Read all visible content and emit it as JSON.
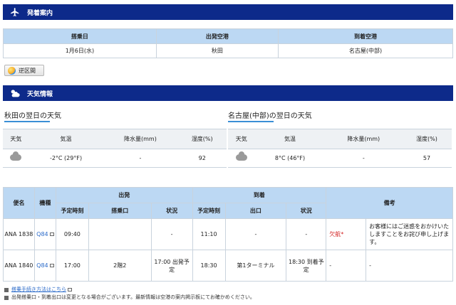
{
  "arrivals_section": {
    "title": "発着案内",
    "icon": "airplane-icon"
  },
  "route_table": {
    "headers": [
      "搭乗日",
      "出発空港",
      "到着空港"
    ],
    "values": [
      "1月6日(水)",
      "秋田",
      "名古屋(中部)"
    ]
  },
  "reverse_button": {
    "label": "逆区間",
    "icon": "globe-icon"
  },
  "weather_section": {
    "title": "天気情報",
    "icon": "weather-icon"
  },
  "weather": [
    {
      "title": "秋田の翌日の天気",
      "headers": [
        "天気",
        "気温",
        "降水量(mm)",
        "湿度(%)"
      ],
      "icon": "cloud-icon",
      "temperature": "-2°C (29°F)",
      "precipitation": "-",
      "humidity": "92"
    },
    {
      "title": "名古屋(中部)の翌日の天気",
      "headers": [
        "天気",
        "気温",
        "降水量(mm)",
        "湿度(%)"
      ],
      "icon": "cloud-icon",
      "temperature": "8°C (46°F)",
      "precipitation": "-",
      "humidity": "57"
    }
  ],
  "flights": {
    "headers": {
      "flight": "便名",
      "aircraft": "機種",
      "departure": "出発",
      "arrival": "到着",
      "remarks": "備考",
      "dep_scheduled": "予定時刻",
      "dep_gate": "搭乗口",
      "dep_status": "状況",
      "arr_scheduled": "予定時刻",
      "arr_exit": "出口",
      "arr_status": "状況"
    },
    "rows": [
      {
        "flight": "ANA 1838",
        "aircraft": "Q84",
        "dep_time": "09:40",
        "dep_gate": "",
        "dep_status": "-",
        "arr_time": "11:10",
        "arr_exit": "-",
        "arr_status": "-",
        "status_note": "欠航*",
        "remarks": "お客様にはご迷惑をおかけいたしますことをお詫び申し上げます。"
      },
      {
        "flight": "ANA 1840",
        "aircraft": "Q84",
        "dep_time": "17:00",
        "dep_gate": "2階2",
        "dep_status": "17:00 出発予定",
        "arr_time": "18:30",
        "arr_exit": "第1ターミナル",
        "arr_status": "18:30 到着予定",
        "status_note": "-",
        "remarks": "-"
      }
    ]
  },
  "notes": {
    "link": "搭乗手続き方法はこちら",
    "text": "出発搭乗口・到着出口は変更となる場合がございます。最新情報は空港の案内掲示板にてお確かめください。"
  },
  "colors": {
    "header_bg": "#0d2a8a",
    "table_header": "#bcd8f3",
    "canceled": "#d21d1d",
    "link": "#2a6ac9"
  }
}
